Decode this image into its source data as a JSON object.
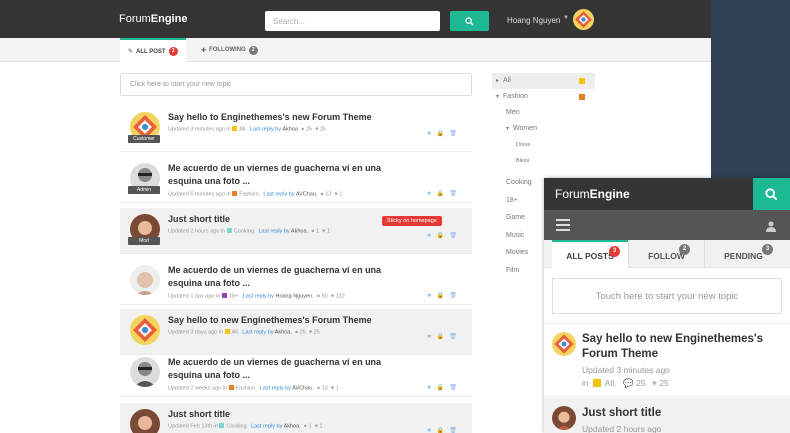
{
  "header": {
    "logo_a": "Forum",
    "logo_b": "Engine",
    "search_placeholder": "Search...",
    "username": "Hoang Nguyen"
  },
  "tabs": [
    {
      "label": "ALL POST",
      "badge": "3"
    },
    {
      "label": "FOLLOWING",
      "badge": "2"
    }
  ],
  "compose_placeholder": "Click here to start your new topic",
  "posts": [
    {
      "title": "Say hello to Enginethemes's new Forum Theme",
      "role": "Customer",
      "time": "Updated 3 minutes ago in",
      "category": "All.",
      "cat_color": "#f1c40f",
      "last_reply": "Last reply by",
      "by": "Akhoa",
      "comments": "25",
      "likes": "25"
    },
    {
      "title": "Me acuerdo de un viernes de guacherna ví en una esquina una foto ...",
      "role": "Admin",
      "time": "Updated 5 minutes ago in",
      "category": "Fashion.",
      "cat_color": "#e67e22",
      "last_reply": "Last reply by",
      "by": "AVChau.",
      "comments": "13",
      "likes": "1"
    },
    {
      "title": "Just short title",
      "role": "Mod",
      "time": "Updated 2 hours ago in",
      "category": "Cooking.",
      "cat_color": "#7fd6d0",
      "last_reply": "Last reply by",
      "by": "Akhoa.",
      "comments": "1",
      "likes": "1",
      "sticky": "Sticky on homepage"
    },
    {
      "title": "Me acuerdo de un viernes de guacherna ví en una esquina una foto ...",
      "time": "Updated 1 day ago in",
      "category": "18+.",
      "cat_color": "#8e44ad",
      "last_reply": "Last reply by",
      "by": "Hoang Nguyen.",
      "comments": "50",
      "likes": "132"
    },
    {
      "title": "Say hello to new Enginethemes's Forum Theme",
      "time": "Updated 3 days ago in",
      "category": "All.",
      "cat_color": "#f1c40f",
      "last_reply": "Last reply by",
      "by": "Akhoa.",
      "comments": "25",
      "likes": "25"
    },
    {
      "title": "Me acuerdo de un viernes de guacherna ví en una esquina una foto ...",
      "time": "Updated 2 weeks ago in",
      "category": "Fashion.",
      "cat_color": "#e67e22",
      "last_reply": "Last reply by",
      "by": "AVChau.",
      "comments": "13",
      "likes": "1"
    },
    {
      "title": "Just short title",
      "time": "Updated Feb 13th in",
      "category": "Cooking.",
      "cat_color": "#7fd6d0",
      "last_reply": "Last reply by",
      "by": "Akhoa.",
      "comments": "1",
      "likes": "1"
    }
  ],
  "categories": [
    {
      "label": "All",
      "color": "#f1c40f"
    },
    {
      "label": "Fashion",
      "color": "#e67e22"
    },
    {
      "label": "Men"
    },
    {
      "label": "Women"
    },
    {
      "label": "Dress"
    },
    {
      "label": "Bikini"
    },
    {
      "label": "Cooking",
      "color": "#7fd6d0"
    },
    {
      "label": "18+"
    },
    {
      "label": "Game"
    },
    {
      "label": "Music"
    },
    {
      "label": "Movies"
    },
    {
      "label": "Film"
    }
  ],
  "mobile": {
    "logo_a": "Forum",
    "logo_b": "Engine",
    "tabs": [
      {
        "label": "ALL POSTS",
        "badge": "3"
      },
      {
        "label": "FOLLOW",
        "badge": "2"
      },
      {
        "label": "PENDING",
        "badge": "3"
      }
    ],
    "compose_placeholder": "Touch here to start your new topic",
    "post1": {
      "title": "Say hello to new Enginethemes's Forum Theme",
      "time": "Updated 3 minutes ago",
      "in": "in",
      "category": "All.",
      "comments": "25",
      "likes": "25"
    },
    "post2": {
      "title": "Just short title",
      "time": "Updated 2 hours ago"
    }
  }
}
